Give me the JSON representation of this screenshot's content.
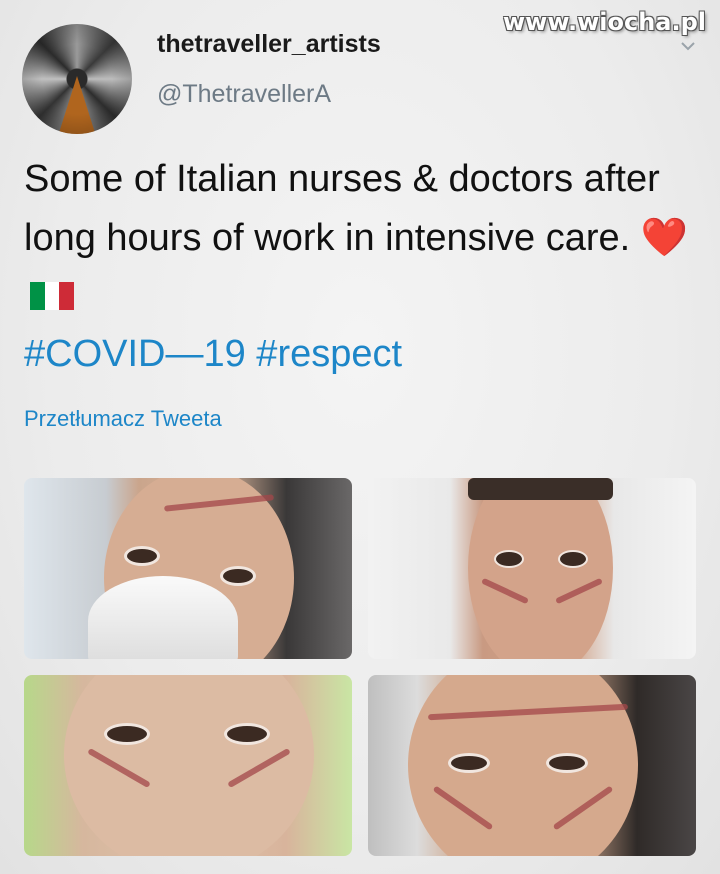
{
  "watermark": "www.wiocha.pl",
  "author": {
    "display_name": "thetraveller_artists",
    "handle": "@ThetravellerA"
  },
  "tweet": {
    "text": "Some of Italian nurses & doctors after long hours of work in intensive care.",
    "heart_emoji": "❤️",
    "flag": "italy-flag",
    "hashtags": "#COVID—19 #respect"
  },
  "translate_label": "Przetłumacz Tweeta",
  "colors": {
    "link": "#1d86c8",
    "flag_green": "#009246",
    "flag_white": "#ffffff",
    "flag_red": "#ce2b37"
  },
  "icons": {
    "menu": "chevron-down-icon",
    "heart": "heart-icon"
  }
}
